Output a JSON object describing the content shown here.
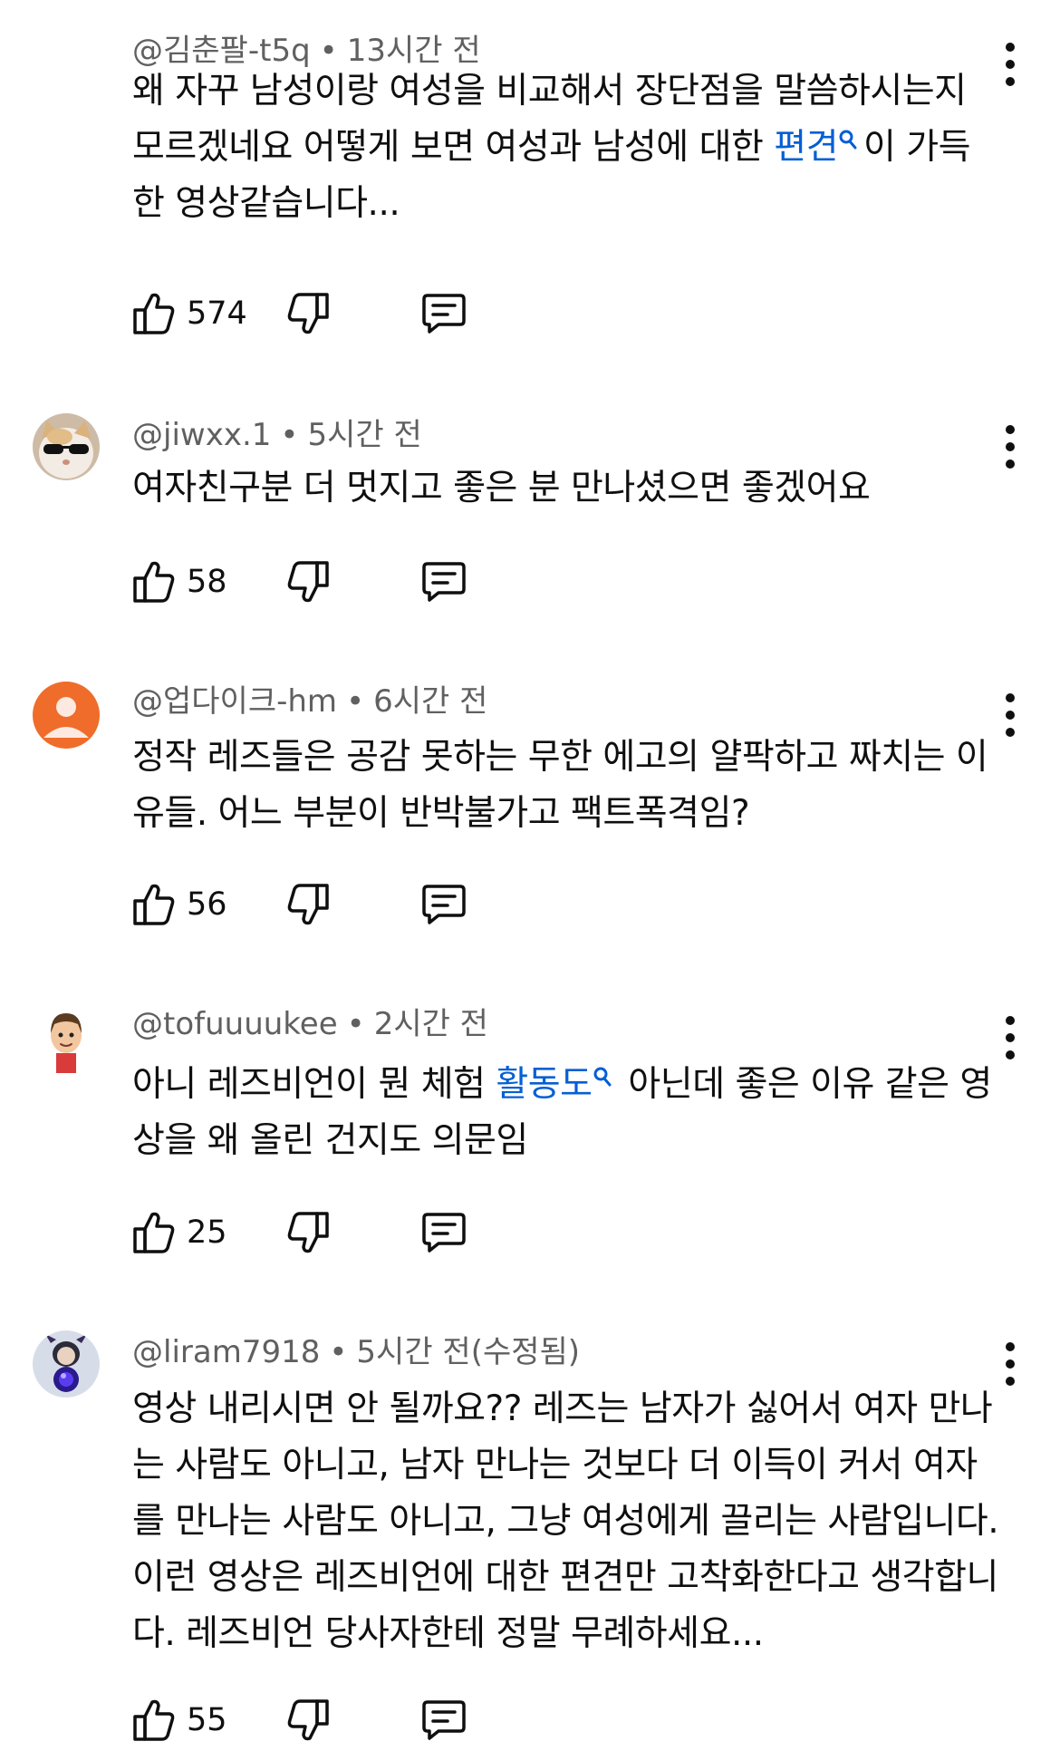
{
  "comments": [
    {
      "author": "@김춘팔-t5q",
      "time": "13시간 전",
      "edited": "",
      "text_before": "왜 자꾸 남성이랑 여성을 비교해서 장단점을 말씀하시는지 모르겠네요 어떻게 보면 여성과 남성에 대한 ",
      "link_text": "편견",
      "text_after": "이 가득한 영상같습니다...",
      "likes": "574",
      "avatar": "none"
    },
    {
      "author": "@jiwxx.1",
      "time": "5시간 전",
      "edited": "",
      "text_before": "여자친구분 더 멋지고 좋은 분 만나셨으면 좋겠어요",
      "link_text": "",
      "text_after": "",
      "likes": "58",
      "avatar": "cat-with-sunglasses"
    },
    {
      "author": "@업다이크-hm",
      "time": "6시간 전",
      "edited": "",
      "text_before": "정작 레즈들은 공감 못하는 무한 에고의 얄팍하고 짜치는 이유들. 어느 부분이 반박불가고 팩트폭격임?",
      "link_text": "",
      "text_after": "",
      "likes": "56",
      "avatar": "default-orange-person"
    },
    {
      "author": "@tofuuuukee",
      "time": "2시간 전",
      "edited": "",
      "text_before": "아니 레즈비언이 뭔 체험 ",
      "link_text": "활동도",
      "text_after": " 아닌데 좋은 이유 같은 영상을 왜 올린 건지도 의문임",
      "likes": "25",
      "avatar": "cartoon-boy"
    },
    {
      "author": "@liram7918",
      "time": "5시간 전",
      "edited": "(수정됨)",
      "text_before": "영상 내리시면 안 될까요?? 레즈는 남자가 싫어서 여자 만나는 사람도 아니고, 남자 만나는 것보다 더 이득이 커서 여자를 만나는 사람도 아니고, 그냥 여성에게 끌리는 사람입니다. 이런 영상은 레즈비언에 대한 편견만 고착화한다고 생각합니다. 레즈비언 당사자한테 정말 무례하세요...",
      "link_text": "",
      "text_after": "",
      "likes": "55",
      "avatar": "character-purple-orb"
    }
  ],
  "colors": {
    "text": "#0f0f0f",
    "meta": "#606060",
    "link": "#065fd4",
    "default_avatar": "#ef6c2b"
  },
  "icons": {
    "like": "thumbs-up-icon",
    "dislike": "thumbs-down-icon",
    "reply": "reply-icon",
    "more": "more-vert-icon",
    "search": "search-icon"
  }
}
